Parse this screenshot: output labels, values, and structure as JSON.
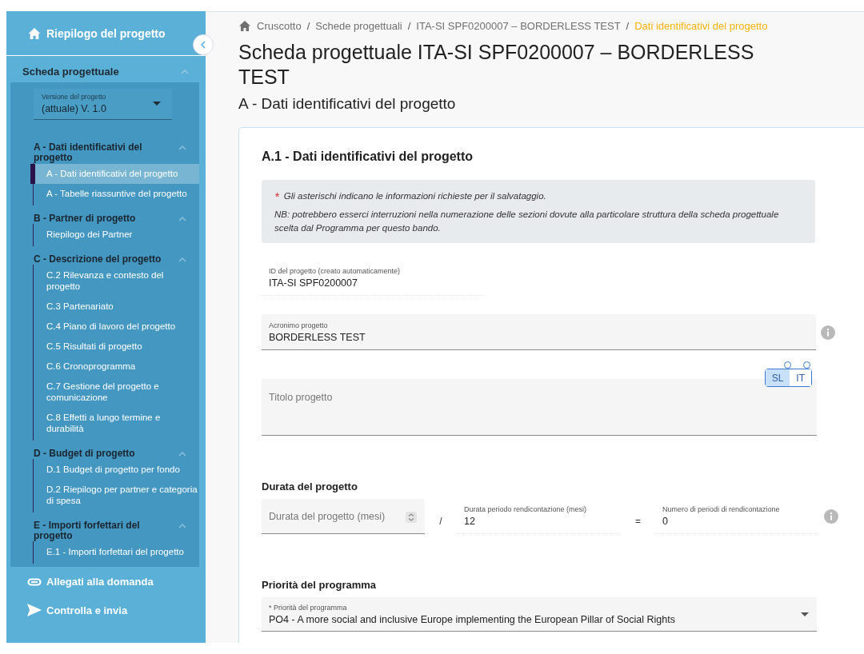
{
  "sidebar": {
    "top_link": {
      "label": "Riepilogo del progetto"
    },
    "section": {
      "title": "Scheda progettuale",
      "expanded": true,
      "version_select": {
        "label": "Versione del progetto",
        "value": "(attuale) V. 1.0"
      },
      "groups": [
        {
          "title": "A - Dati identificativi del progetto",
          "expanded": true,
          "items": [
            {
              "label": "A - Dati identificativi del progetto",
              "selected": true
            },
            {
              "label": "A - Tabelle riassuntive del progetto",
              "selected": false
            }
          ]
        },
        {
          "title": "B - Partner di progetto",
          "expanded": true,
          "items": [
            {
              "label": "Riepilogo dei Partner",
              "selected": false
            }
          ]
        },
        {
          "title": "C - Descrizione del progetto",
          "expanded": true,
          "items": [
            {
              "label": "C.2 Rilevanza e contesto del progetto",
              "selected": false
            },
            {
              "label": "C.3 Partenariato",
              "selected": false
            },
            {
              "label": "C.4 Piano di lavoro del progetto",
              "selected": false
            },
            {
              "label": "C.5 Risultati di progetto",
              "selected": false
            },
            {
              "label": "C.6 Cronoprogramma",
              "selected": false
            },
            {
              "label": "C.7 Gestione del progetto e comunicazione",
              "selected": false
            },
            {
              "label": "C.8 Effetti a lungo termine e durabilità",
              "selected": false
            }
          ]
        },
        {
          "title": "D - Budget di progetto",
          "expanded": true,
          "items": [
            {
              "label": "D.1 Budget di progetto per fondo",
              "selected": false
            },
            {
              "label": "D.2 Riepilogo per partner e categoria di spesa",
              "selected": false
            }
          ]
        },
        {
          "title": "E - Importi forfettari del progetto",
          "expanded": true,
          "items": [
            {
              "label": "E.1 - Importi forfettari del progetto",
              "selected": false
            }
          ]
        }
      ]
    },
    "bottom_links": [
      {
        "kind": "attachment",
        "label": "Allegati alla domanda"
      },
      {
        "kind": "send",
        "label": "Controlla e invia"
      }
    ]
  },
  "breadcrumb_separator": "/",
  "breadcrumb": [
    {
      "label": "Cruscotto",
      "current": false
    },
    {
      "label": "Schede progettuali",
      "current": false
    },
    {
      "label": "ITA-SI SPF0200007 – BORDERLESS TEST",
      "current": false
    },
    {
      "label": "Dati identificativi del progetto",
      "current": true
    }
  ],
  "page_title": "Scheda progettuale ITA-SI SPF0200007 – BORDERLESS TEST",
  "page_subtitle": "A - Dati identificativi del progetto",
  "card": {
    "title": "A.1 - Dati identificativi del progetto",
    "notice": {
      "mark": "*",
      "lines": [
        "Gli asterischi indicano le informazioni richieste per il salvataggio.",
        "NB: potrebbero esserci interruzioni nella numerazione delle sezioni dovute alla particolare struttura della scheda progettuale scelta dal Programma per questo bando."
      ]
    },
    "project_id": {
      "label": "ID del progetto (creato automaticamente)",
      "value": "ITA-SI SPF0200007"
    },
    "acronym": {
      "label": "Acronimo progetto",
      "value": "BORDERLESS TEST"
    },
    "languages": [
      {
        "label": "SL",
        "selected": true
      },
      {
        "label": "IT",
        "selected": false
      }
    ],
    "title_field": {
      "placeholder": "Titolo progetto"
    },
    "duration": {
      "heading": "Durata del progetto",
      "months": {
        "placeholder": "Durata del progetto (mesi)"
      },
      "divide": "/",
      "period": {
        "label": "Durata periodo rendicontazione (mesi)",
        "value": "12"
      },
      "equals": "=",
      "periods": {
        "label": "Numero di periodi di rendicontazione",
        "value": "0"
      }
    },
    "priority": {
      "heading": "Priorità del programma",
      "label": "* Priorità del programma",
      "value": "PO4 - A more social and inclusive Europe implementing the European Pillar of Social Rights"
    }
  }
}
